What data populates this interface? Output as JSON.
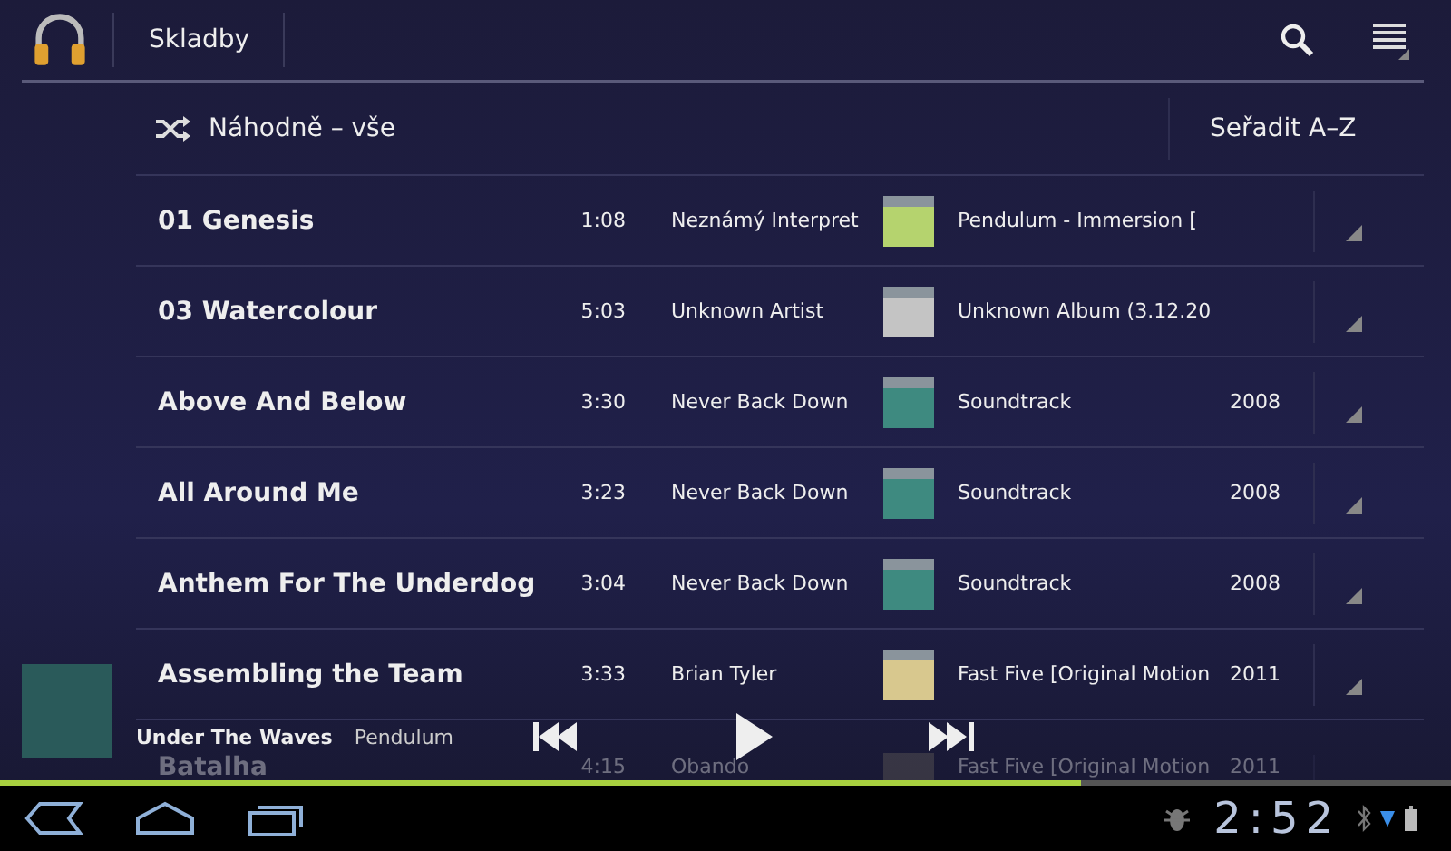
{
  "action_bar": {
    "view_selector": "Skladby"
  },
  "list_header": {
    "shuffle": "Náhodně – vše",
    "sort": "Seřadit A–Z"
  },
  "songs": [
    {
      "title": "01 Genesis",
      "duration": "1:08",
      "artist": "Neznámý Interpret",
      "album": "Pendulum - Immersion [",
      "color": "#b5d36e"
    },
    {
      "title": "03 Watercolour",
      "duration": "5:03",
      "artist": "Unknown Artist",
      "album": "Unknown Album (3.12.20",
      "color": "#c4c4c4"
    },
    {
      "title": "Above And Below",
      "duration": "3:30",
      "artist": "Never Back Down",
      "album": "Soundtrack",
      "year": "2008",
      "color": "#3e8a80"
    },
    {
      "title": "All Around Me",
      "duration": "3:23",
      "artist": "Never Back Down",
      "album": "Soundtrack",
      "year": "2008",
      "color": "#3e8a80"
    },
    {
      "title": "Anthem For The Underdog",
      "duration": "3:04",
      "artist": "Never Back Down",
      "album": "Soundtrack",
      "year": "2008",
      "color": "#3e8a80"
    },
    {
      "title": "Assembling the Team",
      "duration": "3:33",
      "artist": "Brian Tyler",
      "album": "Fast Five [Original Motion",
      "year": "2011",
      "color": "#d8c88e"
    }
  ],
  "partial_song": {
    "title": "Batalha",
    "duration": "4:15",
    "artist": "Obando",
    "album": "Fast Five [Original Motion",
    "year": "2011"
  },
  "now_playing": {
    "title": "Under The Waves",
    "artist": "Pendulum",
    "level": 0.745
  },
  "status_bar": {
    "time": "2:52"
  }
}
